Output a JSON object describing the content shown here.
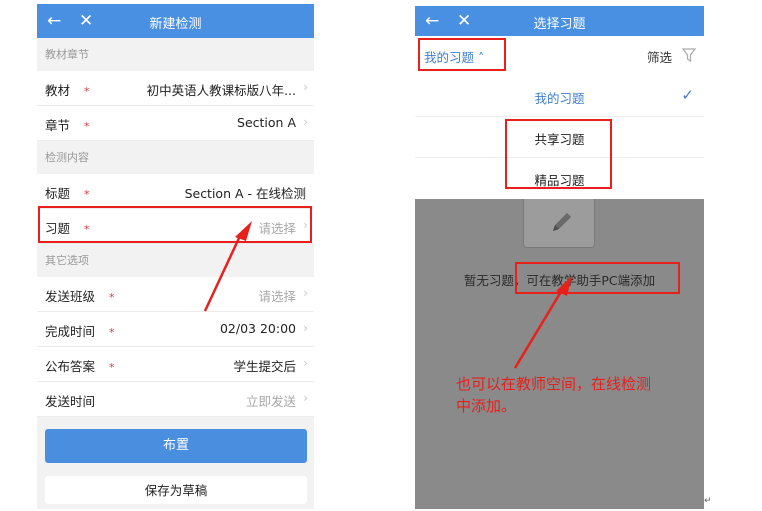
{
  "left_screen": {
    "title": "新建检测",
    "back_glyph": "←",
    "close_glyph": "✕",
    "sections": {
      "textbook": "教材章节",
      "content": "检测内容",
      "other": "其它选项"
    },
    "rows": {
      "textbook": {
        "label": "教材",
        "value": "初中英语人教课标版八年..."
      },
      "chapter": {
        "label": "章节",
        "value": "Section A"
      },
      "title": {
        "label": "标题",
        "value": "Section A - 在线检测"
      },
      "exercise": {
        "label": "习题",
        "value": "请选择"
      },
      "send_class": {
        "label": "发送班级",
        "value": "请选择"
      },
      "finish_time": {
        "label": "完成时间",
        "value": "02/03 20:00"
      },
      "publish_answer": {
        "label": "公布答案",
        "value": "学生提交后"
      },
      "send_time": {
        "label": "发送时间",
        "value": "立即发送"
      }
    },
    "required_mark": "*",
    "chevron": "›",
    "assign_button": "布置",
    "save_draft_button": "保存为草稿"
  },
  "right_screen": {
    "title": "选择习题",
    "back_glyph": "←",
    "close_glyph": "✕",
    "my_exercises_dropdown": "我的习题 ˄",
    "filter_label": "筛选",
    "options": [
      {
        "label": "我的习题",
        "selected": true
      },
      {
        "label": "共享习题",
        "selected": false
      },
      {
        "label": "精品习题",
        "selected": false
      }
    ],
    "check_glyph": "✓",
    "empty_text": "暂无习题，可在教学助手PC端添加",
    "empty_icon": "pencil-paper-icon"
  },
  "annotation": {
    "note_line1": "也可以在教师空间，在线检测",
    "note_line2": "中添加。",
    "color": "#e8201c"
  },
  "paragraph_mark": "↵",
  "colors": {
    "header_blue": "#4a90e2",
    "accent_blue": "#3f7fd1",
    "required_red": "#e0353d",
    "overlay_gray": "#8a8a8a"
  }
}
